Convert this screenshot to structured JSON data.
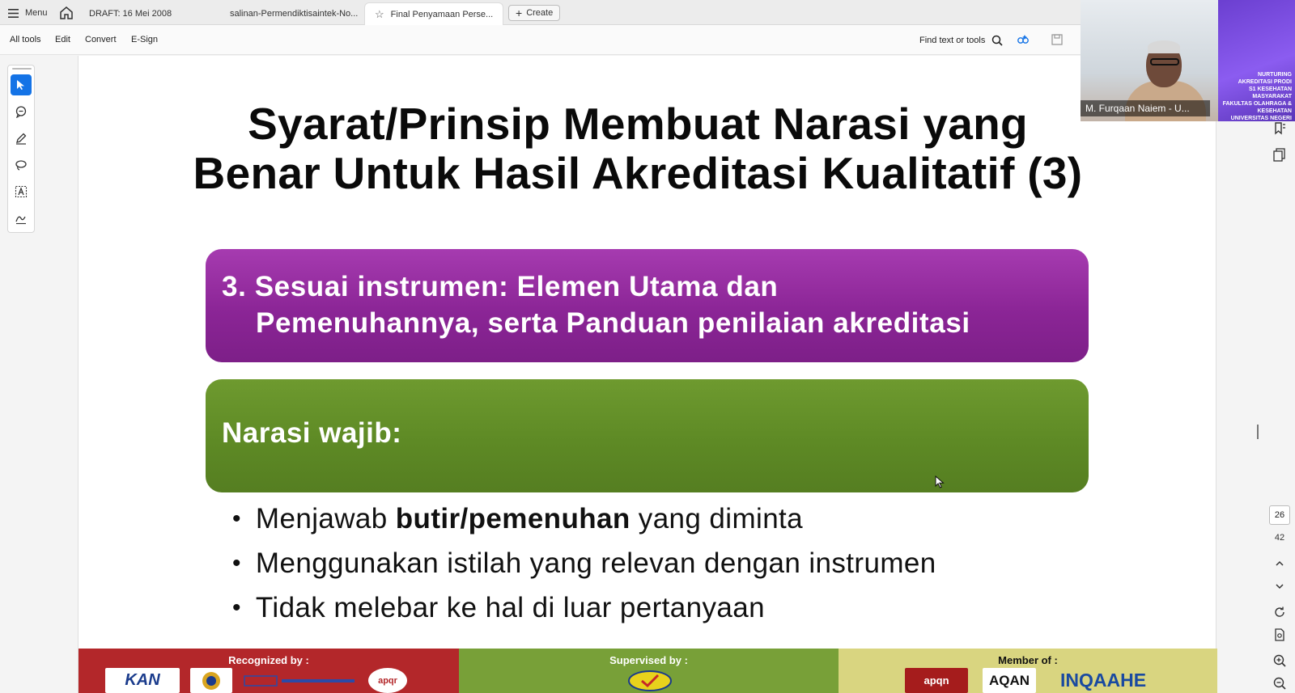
{
  "tabbar": {
    "menu_label": "Menu",
    "tabs": [
      {
        "label": "DRAFT: 16 Mei 2008"
      },
      {
        "label": "salinan-Permendiktisaintek-No..."
      },
      {
        "label": "Final Penyamaan Perse..."
      }
    ],
    "create_label": "Create"
  },
  "toolbar": {
    "items": [
      "All tools",
      "Edit",
      "Convert",
      "E-Sign"
    ],
    "find_label": "Find text or tools"
  },
  "slide": {
    "title_line1": "Syarat/Prinsip Membuat Narasi yang",
    "title_line2": "Benar Untuk Hasil Akreditasi Kualitatif (3)",
    "purple_line1": "3. Sesuai instrumen: Elemen Utama dan",
    "purple_line2": "Pemenuhannya, serta Panduan penilaian akreditasi",
    "green_label": "Narasi wajib:",
    "bullets": [
      {
        "pre": "Menjawab ",
        "bold": "butir/pemenuhan",
        "post": " yang diminta"
      },
      {
        "pre": "Menggunakan istilah yang relevan dengan instrumen",
        "bold": "",
        "post": ""
      },
      {
        "pre": "Tidak melebar ke hal di luar pertanyaan",
        "bold": "",
        "post": ""
      }
    ],
    "footer": {
      "recognized": "Recognized by :",
      "supervised": "Supervised by :",
      "member": "Member of :",
      "logos": {
        "kan": "KAN",
        "apqr": "apqr",
        "apqn": "apqn",
        "aqan": "AQAN",
        "inqaahe": "INQAAHE"
      }
    }
  },
  "page_nav": {
    "current": "26",
    "total": "42"
  },
  "video": {
    "participant_name": "M. Furqaan Naiem - U...",
    "banner_text": [
      "NURTURING",
      "AKREDITASI PRODI",
      "S1 KESEHATAN MASYARAKAT",
      "FAKULTAS OLAHRAGA & KESEHATAN",
      "UNIVERSITAS NEGERI GORONTALO"
    ]
  },
  "colors": {
    "accent": "#1473e6",
    "purple": "#8b2596",
    "green": "#5e8a25"
  }
}
